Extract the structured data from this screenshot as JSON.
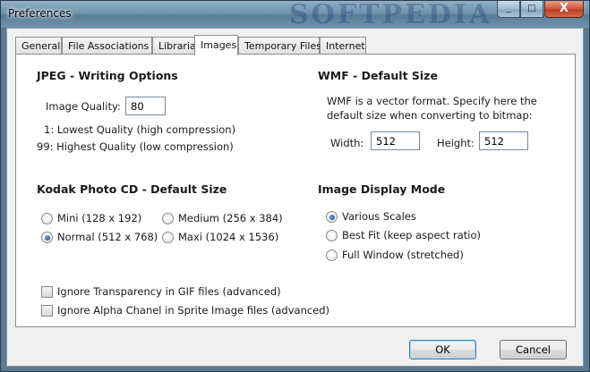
{
  "window": {
    "title": "Preferences",
    "watermark": "SOFTPEDIA"
  },
  "tabs": [
    "General",
    "File Associations",
    "Librarian",
    "Images",
    "Temporary Files",
    "Internet"
  ],
  "active_tab": "Images",
  "jpeg": {
    "heading": "JPEG - Writing Options",
    "quality_label": "Image Quality:",
    "quality_value": "80",
    "hint_low": "1: Lowest Quality (high compression)",
    "hint_high": "99: Highest Quality (low compression)"
  },
  "wmf": {
    "heading": "WMF - Default Size",
    "description_line1": "WMF is a vector format. Specify here the",
    "description_line2": "default size when converting to bitmap:",
    "width_label": "Width:",
    "width_value": "512",
    "height_label": "Height:",
    "height_value": "512"
  },
  "kodak": {
    "heading": "Kodak Photo CD - Default Size",
    "options": [
      {
        "label": "Mini (128 x 192)",
        "checked": false
      },
      {
        "label": "Medium (256 x 384)",
        "checked": false
      },
      {
        "label": "Normal (512 x 768)",
        "checked": true
      },
      {
        "label": "Maxi (1024 x 1536)",
        "checked": false
      }
    ]
  },
  "display_mode": {
    "heading": "Image Display Mode",
    "options": [
      {
        "label": "Various Scales",
        "checked": true
      },
      {
        "label": "Best Fit (keep aspect ratio)",
        "checked": false
      },
      {
        "label": "Full Window (stretched)",
        "checked": false
      }
    ]
  },
  "checkboxes": [
    {
      "label": "Ignore Transparency in GIF files (advanced)",
      "checked": false
    },
    {
      "label": "Ignore Alpha Chanel in Sprite Image files (advanced)",
      "checked": false
    }
  ],
  "buttons": {
    "ok": "OK",
    "cancel": "Cancel"
  },
  "titlebar_buttons": {
    "minimize": "_",
    "maximize": "□",
    "close": "X"
  }
}
